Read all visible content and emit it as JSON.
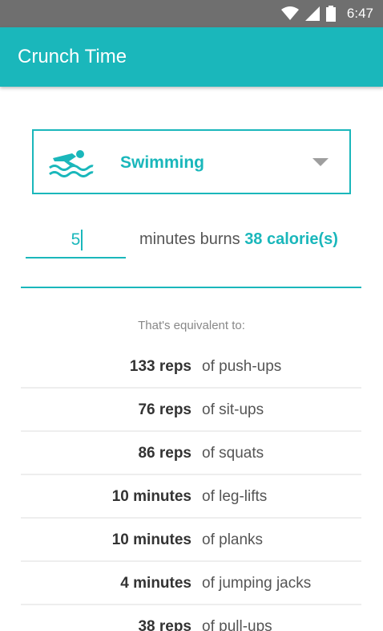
{
  "status_bar": {
    "time": "6:47",
    "icons": [
      "wifi-icon",
      "cell-signal-icon",
      "battery-icon"
    ]
  },
  "app_bar": {
    "title": "Crunch Time"
  },
  "activity_selector": {
    "icon": "swimmer-icon",
    "selected": "Swimming"
  },
  "calculator": {
    "minutes_value": "5",
    "burns_text": "minutes burns",
    "calories": "38 calorie(s)"
  },
  "equivalents": {
    "header": "That's equivalent to:",
    "items": [
      {
        "amount": "133 reps",
        "activity": "of push-ups"
      },
      {
        "amount": "76 reps",
        "activity": "of sit-ups"
      },
      {
        "amount": "86 reps",
        "activity": "of squats"
      },
      {
        "amount": "10 minutes",
        "activity": "of leg-lifts"
      },
      {
        "amount": "10 minutes",
        "activity": "of planks"
      },
      {
        "amount": "4 minutes",
        "activity": "of jumping jacks"
      },
      {
        "amount": "38 reps",
        "activity": "of pull-ups"
      }
    ]
  },
  "colors": {
    "accent": "#1ab7bb",
    "status_bar": "#6f6f6f"
  }
}
